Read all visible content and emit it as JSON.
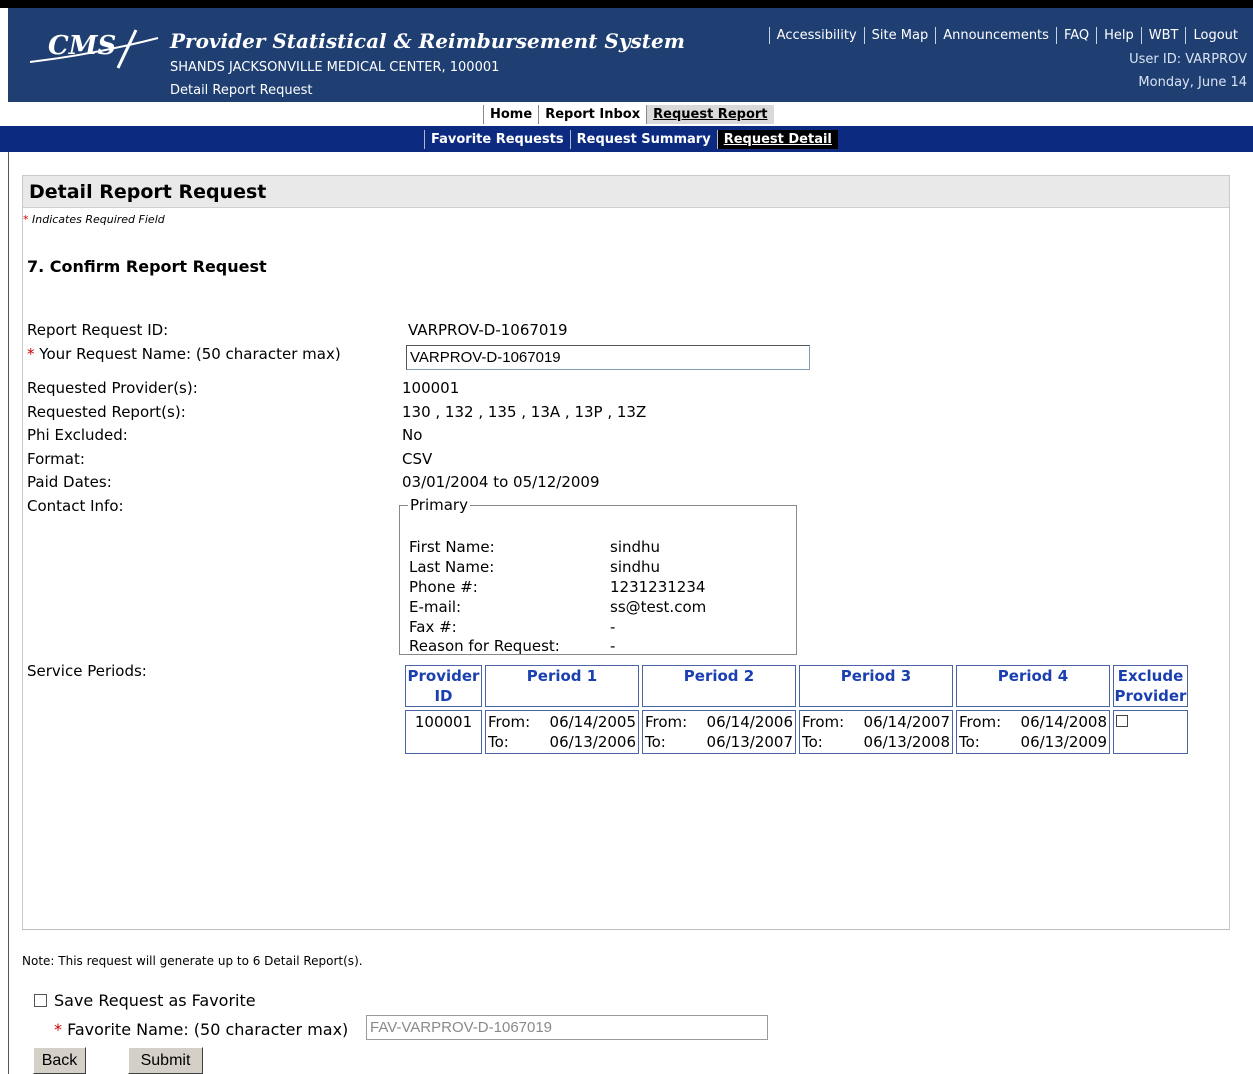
{
  "header": {
    "logo_text": "CMS",
    "app_title": "Provider Statistical & Reimbursement System",
    "facility": "SHANDS JACKSONVILLE MEDICAL CENTER, 100001",
    "page_subtitle": "Detail Report Request",
    "links": [
      "Accessibility",
      "Site Map",
      "Announcements",
      "FAQ",
      "Help",
      "WBT",
      "Logout"
    ],
    "user_id": "User ID: VARPROV",
    "date": "Monday, June 14"
  },
  "nav_primary": [
    "Home",
    "Report Inbox",
    "Request Report"
  ],
  "nav_secondary": [
    "Favorite Requests",
    "Request Summary",
    "Request Detail"
  ],
  "panel": {
    "title": "Detail Report Request",
    "required_note": "Indicates Required Field",
    "step_title": "7.  Confirm Report Request"
  },
  "form": {
    "request_id_label": "Report Request ID:",
    "request_id": "VARPROV-D-1067019",
    "request_name_label": "Your Request Name: (50 character max)",
    "request_name_value": "VARPROV-D-1067019",
    "providers_label": "Requested Provider(s):",
    "providers": "100001",
    "reports_label": "Requested Report(s):",
    "reports": "130 , 132 , 135 , 13A , 13P , 13Z",
    "phi_label": "Phi Excluded:",
    "phi": "No",
    "format_label": "Format:",
    "format": "CSV",
    "paid_dates_label": "Paid Dates:",
    "paid_dates": "03/01/2004 to 05/12/2009",
    "contact_label": "Contact Info:",
    "service_periods_label": "Service Periods:"
  },
  "contact": {
    "legend": "Primary",
    "first_name_label": "First Name:",
    "first_name": "sindhu",
    "last_name_label": "Last Name:",
    "last_name": "sindhu",
    "phone_label": "Phone #:",
    "phone": "1231231234",
    "email_label": "E-mail:",
    "email": "ss@test.com",
    "fax_label": "Fax #:",
    "fax": "-",
    "reason_label": "Reason for  Request:",
    "reason": "-"
  },
  "service_table": {
    "headers": [
      "Provider ID",
      "Period 1",
      "Period 2",
      "Period 3",
      "Period 4",
      "Exclude Provider"
    ],
    "row": {
      "provider_id": "100001",
      "periods": [
        {
          "from_label": "From:",
          "from": "06/14/2005",
          "to_label": "To:",
          "to": "06/13/2006"
        },
        {
          "from_label": "From:",
          "from": "06/14/2006",
          "to_label": "To:",
          "to": "06/13/2007"
        },
        {
          "from_label": "From:",
          "from": "06/14/2007",
          "to_label": "To:",
          "to": "06/13/2008"
        },
        {
          "from_label": "From:",
          "from": "06/14/2008",
          "to_label": "To:",
          "to": "06/13/2009"
        }
      ]
    }
  },
  "footer": {
    "note": "Note: This request will generate up to 6 Detail Report(s).",
    "save_favorite_label": "Save Request as Favorite",
    "favorite_name_label": "Favorite Name: (50 character max)",
    "favorite_name_value": "FAV-VARPROV-D-1067019",
    "back_button": "Back",
    "submit_button": "Submit"
  },
  "colors": {
    "header_bg": "#1f3f73",
    "nav_secondary_bg": "#0c2a80",
    "table_header_text": "#1a3fb0",
    "required_star": "#cc0000"
  }
}
